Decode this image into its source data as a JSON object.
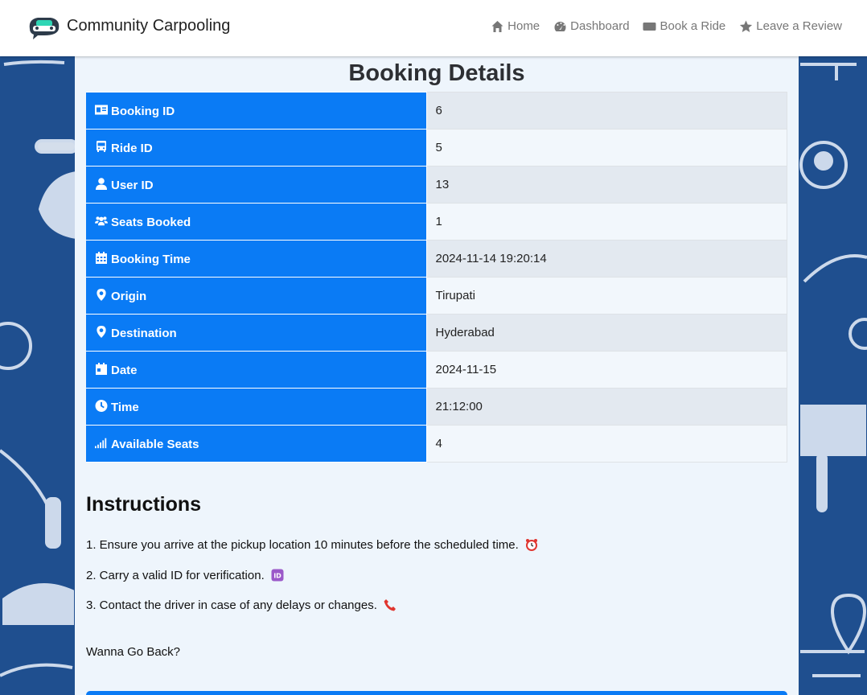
{
  "navbar": {
    "brand": "Community Carpooling",
    "links": [
      {
        "label": "Home",
        "icon": "home-icon"
      },
      {
        "label": "Dashboard",
        "icon": "gauge-icon"
      },
      {
        "label": "Book a Ride",
        "icon": "ticket-icon"
      },
      {
        "label": "Leave a Review",
        "icon": "star-icon"
      }
    ]
  },
  "main": {
    "title": "Booking Details",
    "rows": [
      {
        "label": "Booking ID",
        "value": "6",
        "icon": "id-card-icon"
      },
      {
        "label": "Ride ID",
        "value": "5",
        "icon": "bus-icon"
      },
      {
        "label": "User ID",
        "value": "13",
        "icon": "user-icon"
      },
      {
        "label": "Seats Booked",
        "value": "1",
        "icon": "users-icon"
      },
      {
        "label": "Booking Time",
        "value": "2024-11-14 19:20:14",
        "icon": "calendar-icon"
      },
      {
        "label": "Origin",
        "value": "Tirupati",
        "icon": "map-pin-icon"
      },
      {
        "label": "Destination",
        "value": "Hyderabad",
        "icon": "map-pin-icon"
      },
      {
        "label": "Date",
        "value": "2024-11-15",
        "icon": "calendar-day-icon"
      },
      {
        "label": "Time",
        "value": "21:12:00",
        "icon": "clock-icon"
      },
      {
        "label": "Available Seats",
        "value": "4",
        "icon": "signal-icon"
      }
    ],
    "instructions_title": "Instructions",
    "instructions": [
      {
        "text": "1. Ensure you arrive at the pickup location 10 minutes before the scheduled time.",
        "emoji": "alarm-clock-emoji"
      },
      {
        "text": "2. Carry a valid ID for verification.",
        "emoji": "id-emoji"
      },
      {
        "text": "3. Contact the driver in case of any delays or changes.",
        "emoji": "telephone-emoji"
      }
    ],
    "back_prompt": "Wanna Go Back?",
    "back_button_label": ""
  },
  "colors": {
    "primary": "#0a7bf5",
    "background": "#1f4f8f",
    "panel": "#eef5fc",
    "navbar": "#ffffff",
    "nav_text": "#777777"
  }
}
